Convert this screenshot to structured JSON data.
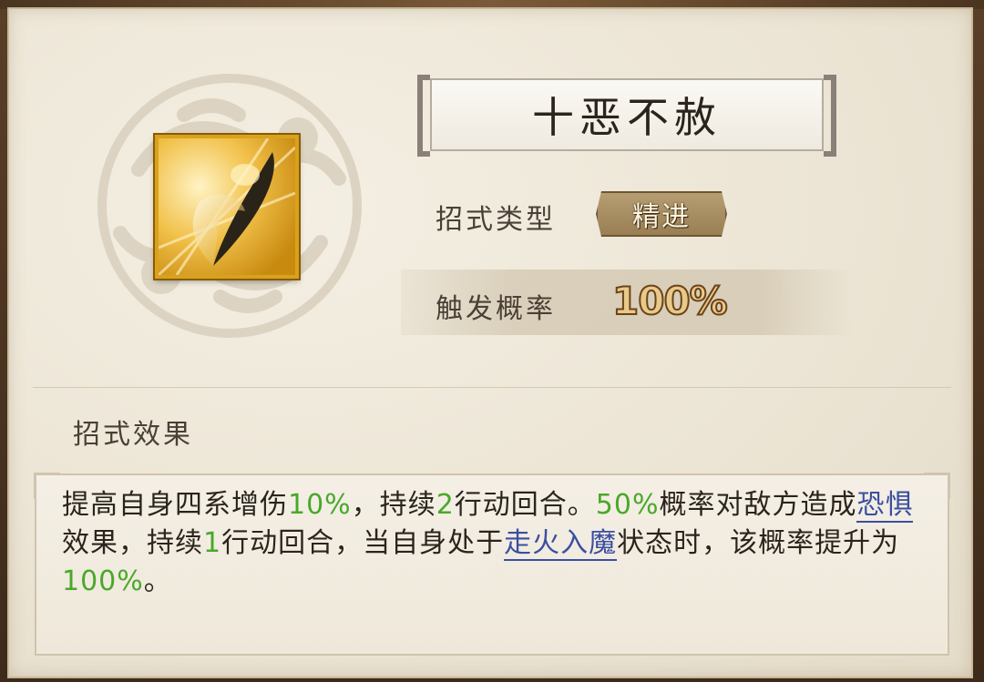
{
  "skill": {
    "title": "十恶不赦",
    "icon": "golden-blade-icon"
  },
  "stats": {
    "type_label": "招式类型",
    "type_value": "精进",
    "prob_label": "触发概率",
    "prob_value": "100%"
  },
  "effects": {
    "label": "招式效果",
    "segments": [
      {
        "text": "提高自身四系增伤"
      },
      {
        "text": "10%"
      },
      {
        "text": "，持续"
      },
      {
        "text": "2"
      },
      {
        "text": "行动回合。"
      },
      {
        "text": "50%"
      },
      {
        "text": "概率对敌方造成"
      },
      {
        "text": "恐惧"
      },
      {
        "text": "效果，持续"
      },
      {
        "text": "1"
      },
      {
        "text": "行动回合，当自身处于"
      },
      {
        "text": "走火入魔"
      },
      {
        "text": "状态时，该概率提升为"
      },
      {
        "text": "100%"
      },
      {
        "text": "。"
      }
    ]
  },
  "colors": {
    "highlight_green": "#4aa82a",
    "link_blue": "#3a4fa0",
    "icon_gold": "#d9a21b"
  }
}
